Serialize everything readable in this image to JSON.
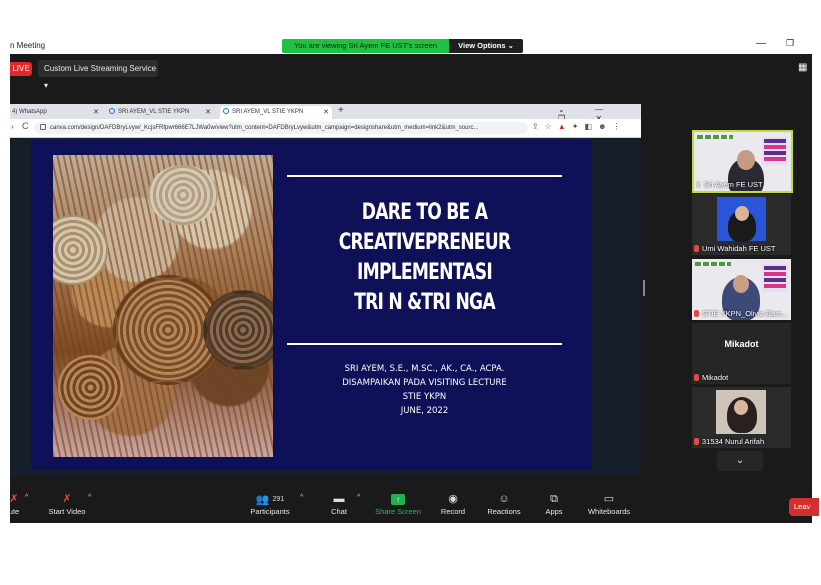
{
  "window": {
    "title": "n Meeting",
    "share_banner": "You are viewing Sri Ayem FE UST's screen",
    "view_options": "View Options ⌄",
    "minimize": "—",
    "maximize": "❐"
  },
  "meeting": {
    "live_badge": "LIVE",
    "stream_button": "Custom Live Streaming Service ▾",
    "grid_icon": "▦"
  },
  "browser": {
    "tabs": [
      {
        "label": "4) WhatsApp",
        "close": "✕"
      },
      {
        "label": "SRI AYEM_VL STIE YKPN",
        "close": "✕"
      },
      {
        "label": "SRI AYEM_VL STIE YKPN",
        "close": "✕"
      }
    ],
    "new_tab": "+",
    "window_controls": "⌄ — ❐ ✕",
    "nav_forward": "›",
    "nav_reload": "C",
    "url": "canva.com/design/DAFDBryLvyw/_KcjsFRfpwr666E7LJWa0w/view?utm_content=DAFDBryLvyw&utm_campaign=designshare&utm_medium=link2&utm_sourc...",
    "toolbar_icons": [
      "⇪",
      "☆"
    ],
    "pdf_icon": "▲",
    "ext_icons": [
      "✦",
      "◧",
      "☻",
      "⋮"
    ]
  },
  "slide": {
    "title_lines": [
      "DARE TO BE A",
      "CREATIVEPRENEUR",
      "IMPLEMENTASI",
      "TRI N &TRI NGA"
    ],
    "sub_lines": [
      "SRI AYEM, S.E., M.SC., AK., CA., ACPA.",
      "DISAMPAIKAN PADA VISITING LECTURE",
      "STIE YKPN",
      "JUNE, 2022"
    ]
  },
  "gallery": {
    "participants": [
      {
        "name": "Sri Ayem FE UST",
        "active": true
      },
      {
        "name": "Umi Wahidah FE UST"
      },
      {
        "name": "STIE YKPN_Olivia Barc..."
      },
      {
        "name": "Mikadot",
        "center_label": "Mikadot"
      },
      {
        "name": "31534 Nurul Arifah"
      }
    ],
    "scroll_down": "⌄"
  },
  "toolbar": {
    "mute": "ute",
    "mute_icon": "✗",
    "start_video": "Start Video",
    "video_icon": "✗",
    "participants": "Participants",
    "participants_count": "291",
    "participants_icon": "👥",
    "chat": "Chat",
    "chat_icon": "▬",
    "share_screen": "Share Screen",
    "share_icon": "↑",
    "record": "Record",
    "record_icon": "◉",
    "reactions": "Reactions",
    "reactions_icon": "☺",
    "apps": "Apps",
    "apps_icon": "⧉",
    "whiteboards": "Whiteboards",
    "whiteboards_icon": "▭",
    "caret": "^",
    "leave": "Leav"
  },
  "colors": {
    "share_banner": "#21c043",
    "live": "#e02828",
    "slide_background": "#0f1158",
    "active_speaker_border": "#c3dc3a",
    "share_screen_green": "#22b14c",
    "leave": "#d32f2f"
  }
}
